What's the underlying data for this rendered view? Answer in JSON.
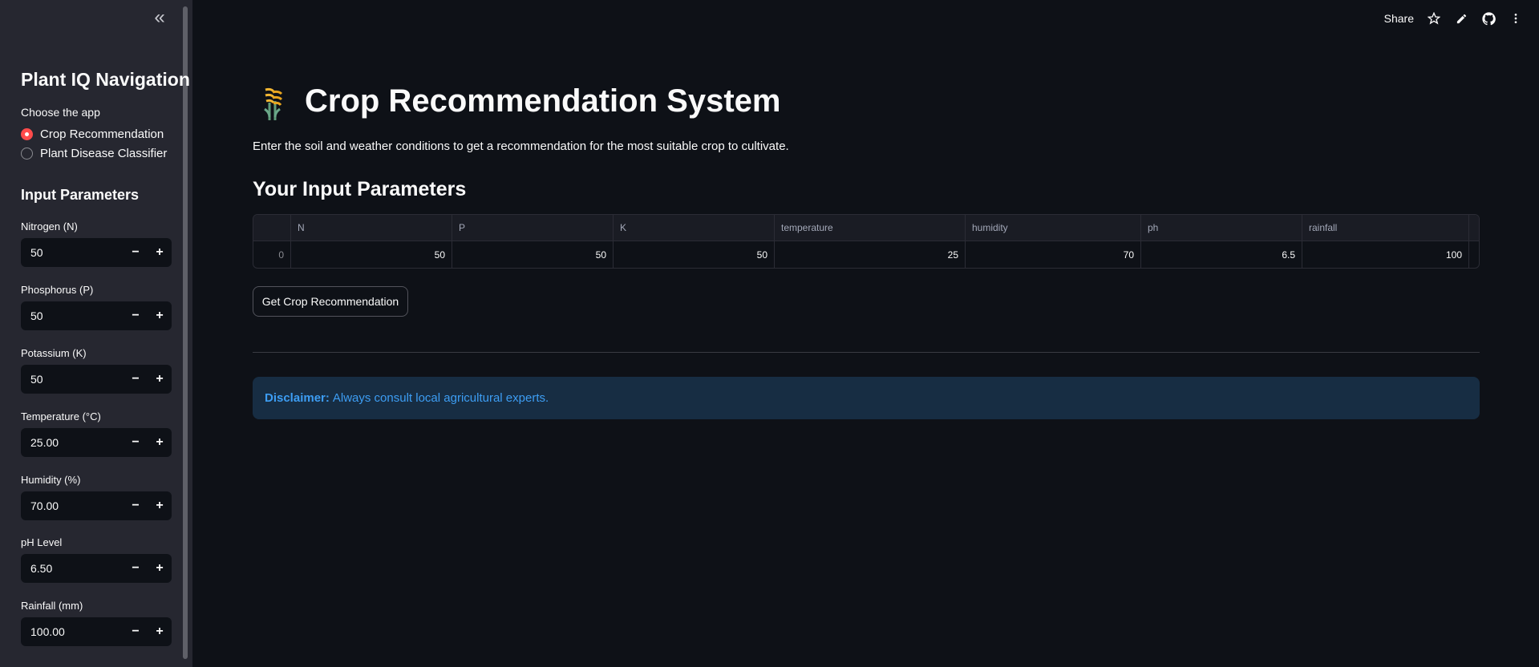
{
  "sidebar": {
    "nav_title": "Plant IQ Navigation",
    "radio_label": "Choose the app",
    "radio_options": [
      {
        "label": "Crop Recommendation",
        "selected": true
      },
      {
        "label": "Plant Disease Classifier",
        "selected": false
      }
    ],
    "section_title": "Input Parameters",
    "inputs": [
      {
        "label": "Nitrogen (N)",
        "value": "50"
      },
      {
        "label": "Phosphorus (P)",
        "value": "50"
      },
      {
        "label": "Potassium (K)",
        "value": "50"
      },
      {
        "label": "Temperature (°C)",
        "value": "25.00"
      },
      {
        "label": "Humidity (%)",
        "value": "70.00"
      },
      {
        "label": "pH Level",
        "value": "6.50"
      },
      {
        "label": "Rainfall (mm)",
        "value": "100.00"
      }
    ],
    "stepper_minus": "−",
    "stepper_plus": "+",
    "collapse_glyph": "«"
  },
  "header": {
    "share_label": "Share"
  },
  "main": {
    "title": "Crop Recommendation System",
    "description": "Enter the soil and weather conditions to get a recommendation for the most suitable crop to cultivate.",
    "subheading": "Your Input Parameters",
    "table": {
      "columns": [
        "",
        "N",
        "P",
        "K",
        "temperature",
        "humidity",
        "ph",
        "rainfall"
      ],
      "rows": [
        [
          "0",
          "50",
          "50",
          "50",
          "25",
          "70",
          "6.5",
          "100"
        ]
      ]
    },
    "button_label": "Get Crop Recommendation",
    "alert": {
      "bold": "Disclaimer:",
      "text": "Always consult local agricultural experts."
    }
  },
  "colors": {
    "accent": "#ff4b4b",
    "background": "#0e1117",
    "sidebar_bg": "#262730",
    "info_text": "#3d9df3",
    "info_bg": "#172d43"
  },
  "icons": [
    "chevron-double-left-icon",
    "star-icon",
    "pencil-icon",
    "github-icon",
    "more-vert-icon",
    "crop-logo-icon"
  ]
}
